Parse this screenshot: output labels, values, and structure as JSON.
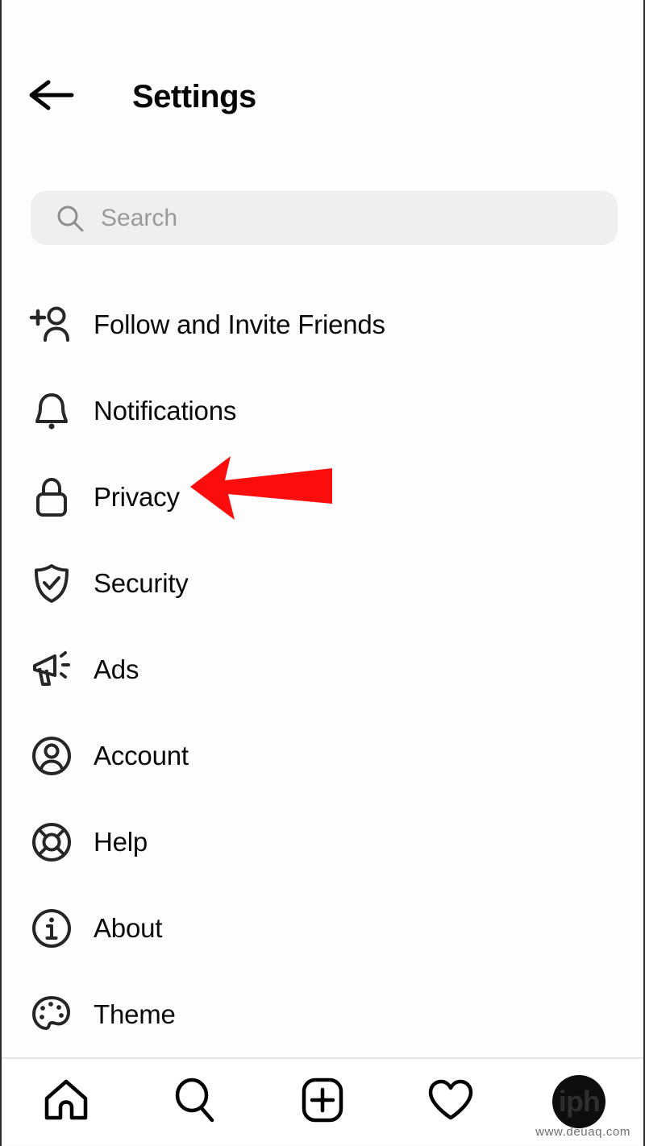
{
  "header": {
    "title": "Settings",
    "back_icon": "arrow-left-icon"
  },
  "search": {
    "placeholder": "Search",
    "value": "",
    "icon": "search-icon"
  },
  "settings_items": [
    {
      "label": "Follow and Invite Friends",
      "icon": "person-plus-icon"
    },
    {
      "label": "Notifications",
      "icon": "bell-icon"
    },
    {
      "label": "Privacy",
      "icon": "lock-icon"
    },
    {
      "label": "Security",
      "icon": "shield-check-icon"
    },
    {
      "label": "Ads",
      "icon": "megaphone-icon"
    },
    {
      "label": "Account",
      "icon": "person-circle-icon"
    },
    {
      "label": "Help",
      "icon": "life-ring-icon"
    },
    {
      "label": "About",
      "icon": "info-circle-icon"
    },
    {
      "label": "Theme",
      "icon": "palette-icon"
    }
  ],
  "annotation": {
    "type": "arrow",
    "direction": "left",
    "color": "#FB0D0D",
    "points_to": "Privacy"
  },
  "bottom_nav": [
    {
      "name": "home",
      "icon": "home-icon"
    },
    {
      "name": "search",
      "icon": "search-icon"
    },
    {
      "name": "create",
      "icon": "plus-square-icon"
    },
    {
      "name": "activity",
      "icon": "heart-icon"
    },
    {
      "name": "profile",
      "icon": "avatar",
      "avatar_text": "iph"
    }
  ],
  "watermark": "www.deuaq.com",
  "colors": {
    "background": "#FDFDFD",
    "text": "#0A0A0A",
    "placeholder": "#9A9A9A",
    "search_bg": "#EFEFEF",
    "accent_red": "#FB0D0D"
  }
}
